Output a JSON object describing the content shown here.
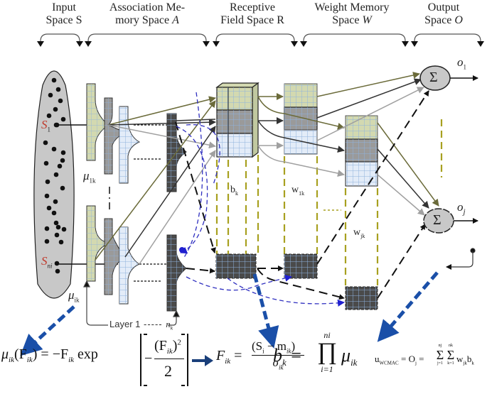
{
  "headers": [
    {
      "line1": "Input",
      "line2": "Space S",
      "italic_var": ""
    },
    {
      "line1": "Association Me-",
      "line2": "mory Space ",
      "italic_var": "A"
    },
    {
      "line1": "Receptive",
      "line2": "Field Space R",
      "italic_var": ""
    },
    {
      "line1": "Weight Memory",
      "line2": "Space ",
      "italic_var": "W"
    },
    {
      "line1": "Output",
      "line2": "Space ",
      "italic_var": "O"
    }
  ],
  "labels": {
    "s1": "S",
    "s1_sub": "1",
    "sni": "S",
    "sni_sub": "ni",
    "mu1k": "μ",
    "mu1k_sub": "1k",
    "muik": "μ",
    "muik_sub": "ik",
    "bk": "b",
    "bk_sub": "k",
    "w1k": "w",
    "w1k_sub": "1k",
    "wjk": "w",
    "wjk_sub": "jk",
    "o1": "o",
    "o1_sub": "1",
    "oj": "o",
    "oj_sub": "j",
    "sigma": "Σ",
    "layer": "Layer 1",
    "nk": "n",
    "nk_sub": "k"
  },
  "equations": {
    "membership": "μik(Fik) = −Fik exp[ −(Fik)² / 2 ]",
    "membership_lhs": "μ",
    "membership_lhs_sub": "ik",
    "membership_arg": "(F",
    "membership_arg_sub": "ik",
    "membership_rhs_pre": ") = −F",
    "membership_rhs_sub": "ik",
    "membership_exp": "exp",
    "membership_num": "(F",
    "membership_num_sub": "ik",
    "membership_num_post": ")",
    "membership_num_pow": "2",
    "membership_den": "2",
    "f_lhs": "F",
    "f_lhs_sub": "ik",
    "f_num": "(S",
    "f_num_sub1": "i",
    "f_num_mid": " − m",
    "f_num_sub2": "ik",
    "f_num_post": ")",
    "f_den": "σ",
    "f_den_sub": "ik",
    "bk_lhs": "b",
    "bk_lhs_sub": "k",
    "bk_prod_top": "ni",
    "bk_prod_bottom": "i=1",
    "bk_prod": "∏",
    "bk_term": "μ",
    "bk_term_sub": "ik",
    "u_lhs": "u",
    "u_lhs_sub": "WCMAC",
    "u_mid": " = O",
    "u_mid_sub": "j",
    "u_sum1_top": "nj",
    "u_sum1_bottom": "j=1",
    "u_sum2_top": "nk",
    "u_sum2_bottom": "k=1",
    "u_term": "w",
    "u_term_sub": "jk",
    "u_term2": "b",
    "u_term2_sub": "k"
  },
  "colors": {
    "olive": "#6b6b3a",
    "olive_dash": "#a8a020",
    "dark": "#333333",
    "gray": "#a0a0a0",
    "blue_dash": "#3030c0",
    "blue_thick": "#1a4fa8",
    "green_fill": "#d3d9b0",
    "gray_fill": "#9a9a9a",
    "light_fill": "#e3ecf8",
    "dark_fill": "#4a4a4a",
    "input_fill": "#c8c8c8",
    "red_label": "#c0392b"
  }
}
